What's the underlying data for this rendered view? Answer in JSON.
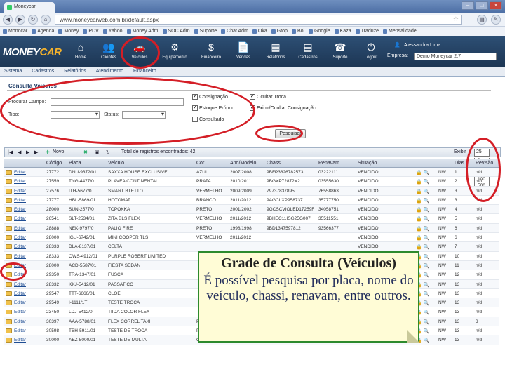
{
  "browser": {
    "tab_title": "Moneycar",
    "url": "www.moneycarweb.com.br/default.aspx",
    "bookmarks": [
      "Monocar",
      "Agenda",
      "Money",
      "PDV",
      "Yahoo",
      "Money Adm",
      "SOC Adm",
      "Suporte",
      "Chat Adm",
      "Oka",
      "Gtop",
      "Bol",
      "Google",
      "Kaza",
      "Traduze",
      "Mensalidade"
    ]
  },
  "app": {
    "logo_main": "MONEY",
    "logo_accent": "CAR",
    "modules": [
      "Home",
      "Clientes",
      "Veículos",
      "Equipamento",
      "Financeiro",
      "Vendas",
      "Relatórios",
      "Cadastros",
      "Suporte",
      "Logout"
    ],
    "user_label": "Alessandra Lima",
    "company_label": "Empresa:",
    "company_value": "Demo Moneycar 2.7",
    "menu": [
      "Sistema",
      "Cadastros",
      "Relatórios",
      "Atendimento",
      "Financeiro"
    ]
  },
  "filters": {
    "title": "Consulta Veículos",
    "search_label": "Procurar Campo:",
    "type_label": "Tipo:",
    "status_label": "Status:",
    "checkboxes": [
      {
        "label": "Consignação",
        "checked": true
      },
      {
        "label": "Estoque Próprio",
        "checked": true
      },
      {
        "label": "Consultado",
        "checked": false
      },
      {
        "label": "Ocultar Troca",
        "checked": true
      },
      {
        "label": "Exibir/Ocultar Consignação",
        "checked": true
      }
    ],
    "search_button": "Pesquisar"
  },
  "grid": {
    "toolbar_new": "Novo",
    "toolbar_total": "Total de registros encontrados: 42",
    "page_size_label": "Exibir",
    "page_size": "25",
    "page_size_options": [
      "0",
      "25",
      "50",
      "100",
      "500",
      "Todos"
    ],
    "columns": [
      "",
      "Código",
      "Placa",
      "Veículo",
      "Cor",
      "Ano/Modelo",
      "Chassi",
      "Renavam",
      "Situação",
      "",
      "",
      "Dias",
      "Revisão"
    ],
    "edit_label": "Editar",
    "rows": [
      [
        "27772",
        "DNU-9372/01",
        "SAXXA HOUSE EXCLUSIVE",
        "AZUL",
        "2007/2008",
        "9BFP3826782573",
        "03222111",
        "VENDIDO",
        "NW",
        "1",
        "n/d"
      ],
      [
        "27559",
        "TNG-4477/0",
        "PLAVEA CONTINENTAL",
        "PRATA",
        "2010/2011",
        "9BGXP72872X2",
        "03555630",
        "VENDIDO",
        "NW",
        "2",
        "n/d"
      ],
      [
        "27576",
        "ITH-5677/0",
        "SMART BTETTO",
        "VERMELHO",
        "2009/2009",
        "79737837895",
        "76558863",
        "VENDIDO",
        "NW",
        "3",
        "n/d"
      ],
      [
        "27777",
        "HBL-5869/01",
        "HOTOMAT",
        "BRANCO",
        "2011/2012",
        "9AGCLXP958737",
        "35777750",
        "VENDIDO",
        "NW",
        "3",
        "n/d"
      ],
      [
        "28000",
        "SUN-2577/0",
        "TOPOKKA",
        "PRETO",
        "2001/2002",
        "9GCSCVIOLED17259F",
        "34058751",
        "VENDIDO",
        "NW",
        "4",
        "n/d"
      ],
      [
        "26541",
        "SLT-2534/01",
        "ZITA BLS FLEX",
        "VERMELHO",
        "2011/2012",
        "9BHEC11ISG25G007",
        "35511551",
        "VENDIDO",
        "NW",
        "5",
        "n/d"
      ],
      [
        "28888",
        "NEK-9797/0",
        "PALIO FIRE",
        "PRETO",
        "1998/1998",
        "9BD1347597812",
        "93566377",
        "VENDIDO",
        "NW",
        "6",
        "n/d"
      ],
      [
        "28000",
        "IGU-6742/01",
        "MINI COOPER TLS",
        "VERMELHO",
        "2011/2012",
        "",
        "",
        "VENDIDO",
        "NW",
        "6",
        "n/d"
      ],
      [
        "28333",
        "DLA-8137/01",
        "CELTA",
        "",
        "",
        "",
        "",
        "VENDIDO",
        "NW",
        "7",
        "n/d"
      ],
      [
        "28333",
        "OWS-4912/01",
        "PURPLE ROBERT LIMITED",
        "",
        "",
        "",
        "",
        "VENDIDO",
        "NW",
        "10",
        "n/d"
      ],
      [
        "28000",
        "ACD-5587/01",
        "FIESTA SEDAN",
        "",
        "",
        "",
        "",
        "VENDIDO",
        "NW",
        "11",
        "n/d"
      ],
      [
        "29350",
        "TRA-1347/01",
        "FUSCA",
        "",
        "",
        "",
        "",
        "VENDIDO",
        "NW",
        "12",
        "n/d"
      ],
      [
        "28332",
        "KKJ-5412/01",
        "PASSAT CC",
        "",
        "",
        "",
        "",
        "VENDIDO",
        "NW",
        "13",
        "n/d"
      ],
      [
        "29547",
        "TTT-6666/01",
        "CLOE",
        "",
        "",
        "",
        "",
        "VENDIDO",
        "NW",
        "13",
        "n/d"
      ],
      [
        "29549",
        "I-1111/1T",
        "TESTE TROCA",
        "",
        "",
        "",
        "",
        "VENDIDO",
        "NW",
        "13",
        "n/d"
      ],
      [
        "23450",
        "LDJ-5412/0",
        "TIIDA COLOR FLEX",
        "",
        "",
        "",
        "",
        "VENDIDO",
        "NW",
        "13",
        "n/d"
      ],
      [
        "30397",
        "AAA-5788/01",
        "FLEX CORREL TAXI",
        "PRETO",
        "2011/2012",
        "XXX",
        "5896888",
        "VENDIDO",
        "NW",
        "13",
        "3"
      ],
      [
        "30598",
        "TBH-5911/01",
        "TESTE DE TROCA",
        "PRETO",
        "2011/2012",
        "",
        "",
        "VENDIDO",
        "NW",
        "13",
        "n/d"
      ],
      [
        "30000",
        "AEZ-5000/01",
        "TESTE DE MULTA",
        "CINZA",
        "2011/2012",
        "×",
        "00677760",
        "DISPONÍVEL",
        "NW",
        "13",
        "n/d"
      ]
    ]
  },
  "callout": {
    "title": "Grade de Consulta (Veículos)",
    "body": "É possível pesquisa por placa, nome do veículo, chassi, renavam, entre outros."
  }
}
